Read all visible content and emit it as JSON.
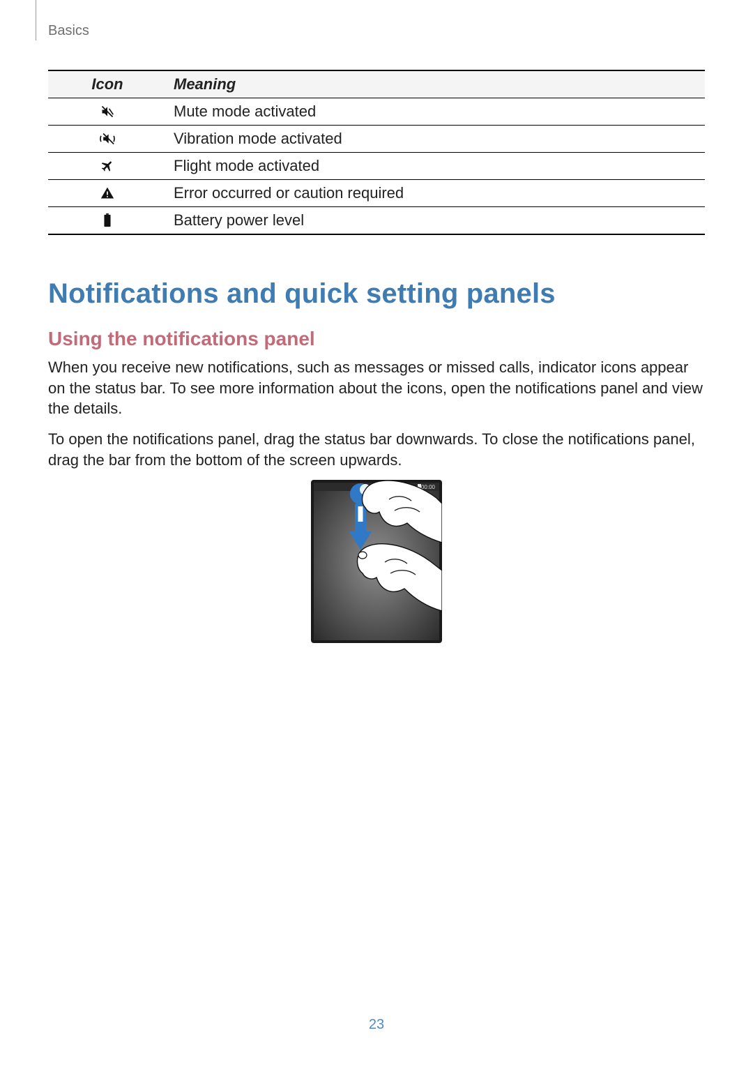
{
  "breadcrumb": "Basics",
  "table": {
    "headers": {
      "icon": "Icon",
      "meaning": "Meaning"
    },
    "rows": [
      {
        "icon": "mute-icon",
        "meaning": "Mute mode activated"
      },
      {
        "icon": "vibration-icon",
        "meaning": "Vibration mode activated"
      },
      {
        "icon": "flight-icon",
        "meaning": "Flight mode activated"
      },
      {
        "icon": "warning-icon",
        "meaning": "Error occurred or caution required"
      },
      {
        "icon": "battery-icon",
        "meaning": "Battery power level"
      }
    ]
  },
  "h1": "Notifications and quick setting panels",
  "h2": "Using the notifications panel",
  "paragraphs": {
    "p1": "When you receive new notifications, such as messages or missed calls, indicator icons appear on the status bar. To see more information about the icons, open the notifications panel and view the details.",
    "p2": "To open the notifications panel, drag the status bar downwards. To close the notifications panel, drag the bar from the bottom of the screen upwards."
  },
  "illustration": {
    "status_time": "00:00"
  },
  "page_number": "23"
}
